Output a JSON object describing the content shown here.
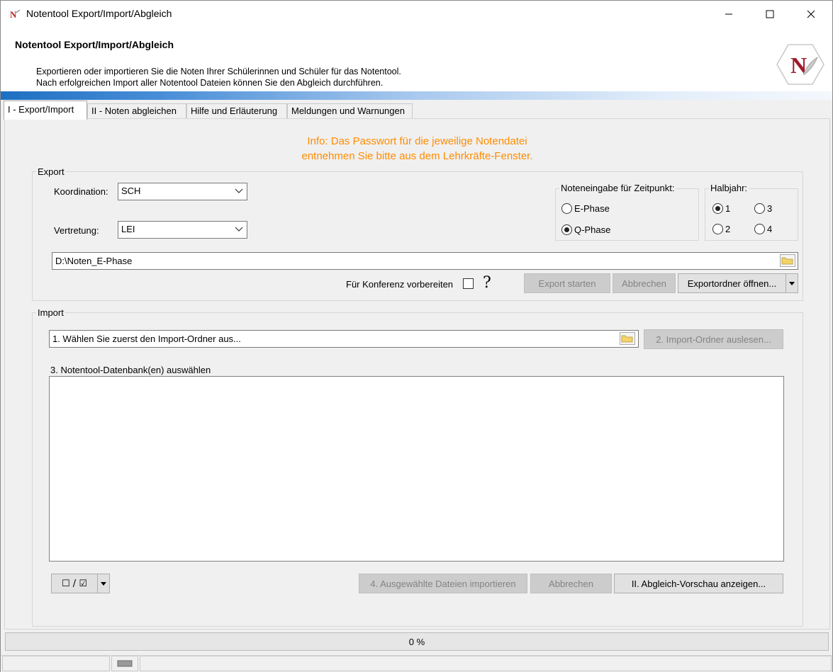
{
  "window": {
    "title": "Notentool Export/Import/Abgleich",
    "minimize_glyph": "—",
    "maximize_glyph": "☐",
    "close_glyph": "✕"
  },
  "header": {
    "title": "Notentool Export/Import/Abgleich",
    "desc_line1": "Exportieren oder importieren Sie die Noten Ihrer Schülerinnen und Schüler für das Notentool.",
    "desc_line2": "Nach erfolgreichen Import aller Notentool Dateien können Sie den Abgleich durchführen.",
    "logo_letter": "N"
  },
  "tabs": [
    {
      "label": "I - Export/Import",
      "active": true
    },
    {
      "label": "II - Noten abgleichen",
      "active": false
    },
    {
      "label": "Hilfe und Erläuterung",
      "active": false
    },
    {
      "label": "Meldungen und Warnungen",
      "active": false
    }
  ],
  "info": {
    "line1": "Info: Das Passwort für die jeweilige Notendatei",
    "line2": "entnehmen Sie bitte aus dem Lehrkräfte-Fenster.",
    "color": "#ff8c00"
  },
  "export": {
    "group_label": "Export",
    "koordination_label": "Koordination:",
    "koordination_value": "SCH",
    "vertretung_label": "Vertretung:",
    "vertretung_value": "LEI",
    "zeitpunkt_group_label": "Noteneingabe für Zeitpunkt:",
    "zeitpunkt_options": [
      {
        "label": "E-Phase",
        "checked": false
      },
      {
        "label": "Q-Phase",
        "checked": true
      }
    ],
    "halbjahr_group_label": "Halbjahr:",
    "halbjahr_options": [
      {
        "label": "1",
        "checked": true
      },
      {
        "label": "3",
        "checked": false
      },
      {
        "label": "2",
        "checked": false
      },
      {
        "label": "4",
        "checked": false
      }
    ],
    "path_value": "D:\\Noten_E-Phase",
    "konferenz_label": "Für Konferenz vorbereiten",
    "konferenz_checked": false,
    "help_glyph": "?",
    "start_button": "Export starten",
    "cancel_button": "Abbrechen",
    "open_folder_button": "Exportordner öffnen..."
  },
  "import": {
    "group_label": "Import",
    "folder_field_value": "1. Wählen Sie zuerst den Import-Ordner aus...",
    "read_folder_button": "2. Import-Ordner auslesen...",
    "select_db_label": "3. Notentool-Datenbank(en) auswählen",
    "toggle_all_label": "☐ / ☑",
    "import_button": "4. Ausgewählte Dateien importieren",
    "cancel_button": "Abbrechen",
    "preview_button": "II. Abgleich-Vorschau anzeigen..."
  },
  "progress": {
    "text": "0 %",
    "value": 0
  }
}
